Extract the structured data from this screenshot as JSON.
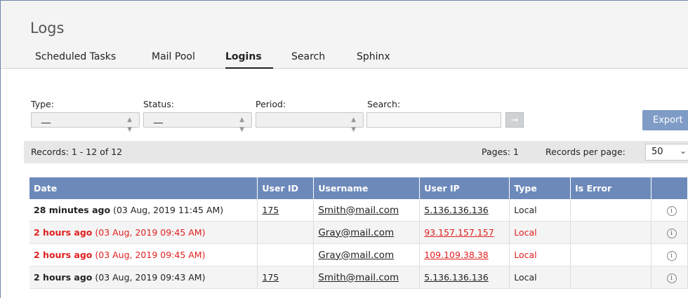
{
  "page": {
    "title": "Logs"
  },
  "tabs": [
    {
      "label": "Scheduled Tasks",
      "active": false
    },
    {
      "label": "Mail Pool",
      "active": false
    },
    {
      "label": "Logins",
      "active": true
    },
    {
      "label": "Search",
      "active": false
    },
    {
      "label": "Sphinx",
      "active": false
    }
  ],
  "filters": {
    "type": {
      "label": "Type:",
      "value": "__"
    },
    "status": {
      "label": "Status:",
      "value": "__"
    },
    "period": {
      "label": "Period:",
      "value": ""
    },
    "search": {
      "label": "Search:",
      "value": "",
      "go": "→"
    },
    "export_label": "Export"
  },
  "records": {
    "summary": "Records: 1 - 12 of 12",
    "pages": "Pages: 1",
    "per_page_label": "Records per page:",
    "per_page_value": "50",
    "chevron": "⌄"
  },
  "table": {
    "columns": [
      "Date",
      "User ID",
      "Username",
      "User IP",
      "Type",
      "Is Error",
      ""
    ],
    "rows": [
      {
        "relative": "28 minutes ago",
        "absolute": "(03 Aug, 2019 11:45 AM)",
        "user_id": "175",
        "username": "Smith@mail.com",
        "ip": "5.136.136.136",
        "type": "Local",
        "error": false
      },
      {
        "relative": "2 hours ago",
        "absolute": "(03 Aug, 2019 09:45 AM)",
        "user_id": "",
        "username": "Gray@mail.com",
        "ip": "93.157.157.157",
        "type": "Local",
        "error": true
      },
      {
        "relative": "2 hours ago",
        "absolute": "(03 Aug, 2019 09:45 AM)",
        "user_id": "",
        "username": "Gray@mail.com",
        "ip": "109.109.38.38",
        "type": "Local",
        "error": true
      },
      {
        "relative": "2 hours ago",
        "absolute": "(03 Aug, 2019 09:43 AM)",
        "user_id": "175",
        "username": "Smith@mail.com",
        "ip": "5.136.136.136",
        "type": "Local",
        "error": false
      }
    ],
    "info_glyph": "i"
  },
  "colors": {
    "header_bg": "#6d89ba",
    "error_text": "#e02020",
    "export_bg": "#7f9cc6"
  }
}
